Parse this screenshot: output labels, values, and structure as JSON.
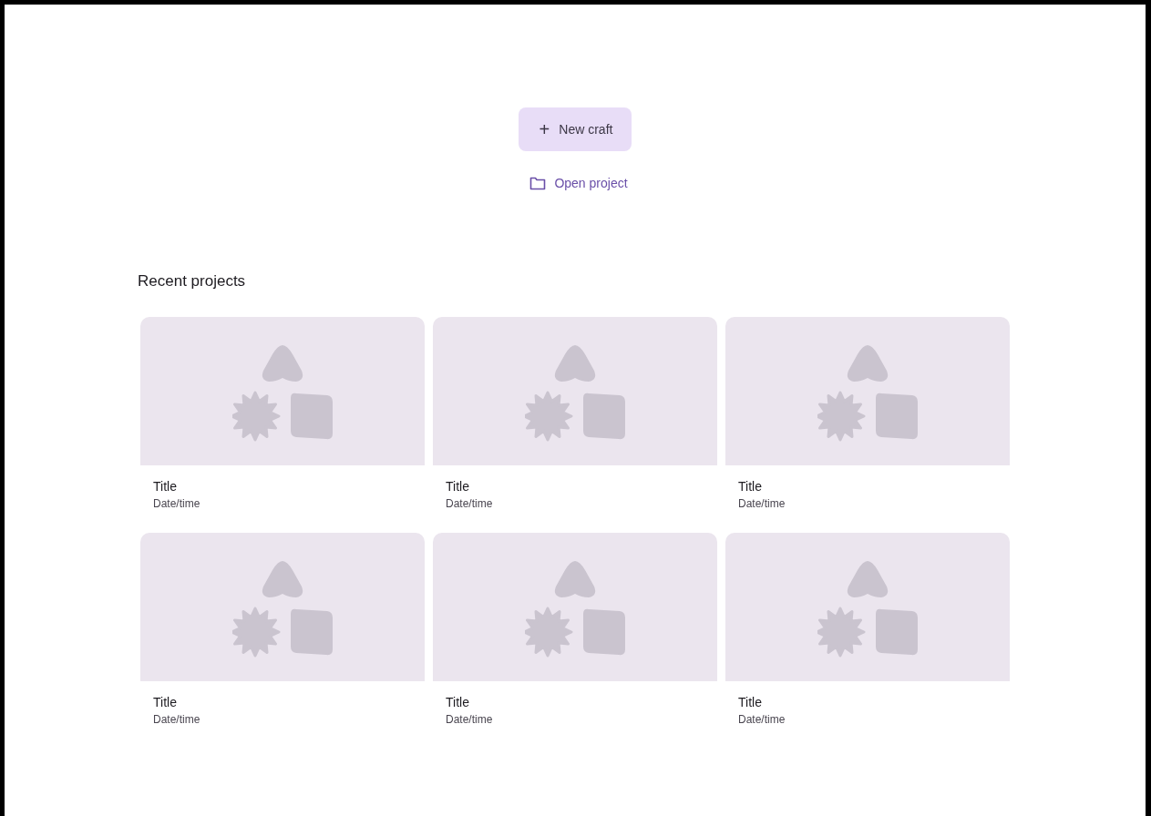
{
  "actions": {
    "new_button": {
      "icon": "+",
      "label": "New craft"
    },
    "open_link": {
      "label": "Open project"
    }
  },
  "recent": {
    "heading": "Recent projects",
    "projects": [
      {
        "title": "Title",
        "subtitle": "Date/time"
      },
      {
        "title": "Title",
        "subtitle": "Date/time"
      },
      {
        "title": "Title",
        "subtitle": "Date/time"
      },
      {
        "title": "Title",
        "subtitle": "Date/time"
      },
      {
        "title": "Title",
        "subtitle": "Date/time"
      },
      {
        "title": "Title",
        "subtitle": "Date/time"
      }
    ]
  }
}
